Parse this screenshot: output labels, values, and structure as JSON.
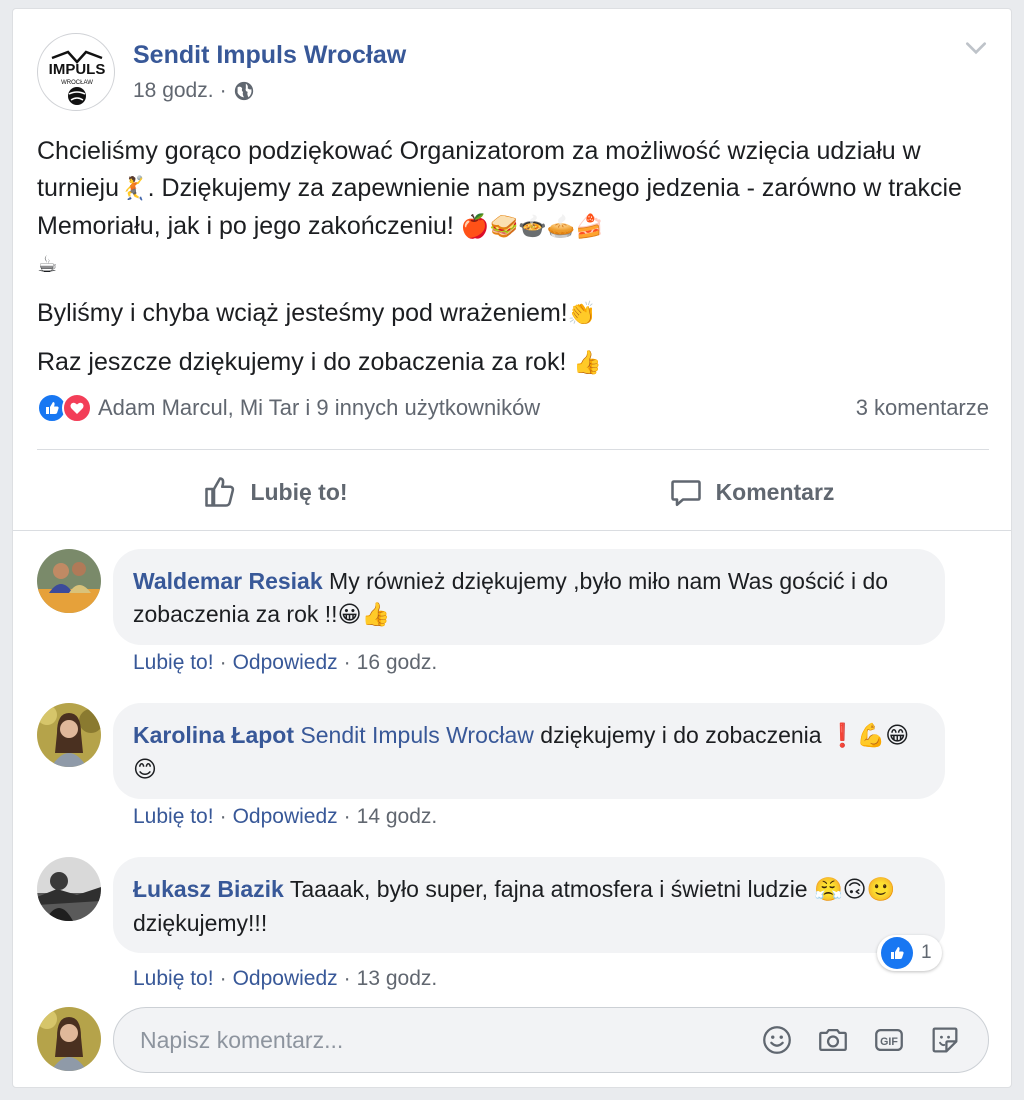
{
  "post": {
    "page_name": "Sendit Impuls Wrocław",
    "logo_text": "IMPULS",
    "logo_subtext": "WROCŁAW",
    "time": "18 godz.",
    "meta_separator": "·",
    "text": {
      "line1": "Chcieliśmy gorąco podziękować Organizatorom za możliwość wzięcia udziału w turnieju",
      "emoji_handball": "🤾",
      "line1b": ". Dziękujemy za zapewnienie nam pysznego jedzenia - zarówno w trakcie Memoriału, jak i po jego zakończeniu! ",
      "emoji_food": "🍎🥪🍲🥧🍰",
      "emoji_coffee": "☕",
      "line2": "Byliśmy i chyba wciąż jesteśmy pod wrażeniem!",
      "emoji_clap": "👏",
      "line3": "Raz jeszcze dziękujemy i do zobaczenia za rok! ",
      "emoji_thumb": "👍"
    },
    "reactions_text": "Adam Marcul, Mi Tar i 9 innych użytkowników",
    "comments_count": "3 komentarze"
  },
  "actions": {
    "like_label": "Lubię to!",
    "comment_label": "Komentarz"
  },
  "comments": [
    {
      "author": "Waldemar Resiak",
      "text": " My również dziękujemy ,było miło nam Was gościć i do zobaczenia za rok !!",
      "emoji": "😀👍",
      "like": "Lubię to!",
      "reply": "Odpowiedz",
      "sep": "·",
      "time": "16 godz."
    },
    {
      "author": "Karolina Łapot",
      "mention": "Sendit Impuls Wrocław",
      "text": " dziękujemy i do zobaczenia ",
      "emoji": "❗💪😁😊",
      "like": "Lubię to!",
      "reply": "Odpowiedz",
      "sep": "·",
      "time": "14 godz."
    },
    {
      "author": "Łukasz Biazik",
      "text": " Taaaak, było super, fajna atmosfera i świetni ludzie ",
      "emoji": "😤🙃🙂",
      "text_end": " dziękujemy!!!",
      "like": "Lubię to!",
      "reply": "Odpowiedz",
      "sep": "·",
      "time": "13 godz.",
      "reaction_count": "1"
    }
  ],
  "composer": {
    "placeholder": "Napisz komentarz..."
  },
  "icons": {
    "like": "like-icon",
    "love": "love-icon",
    "globe": "globe-icon",
    "chevron": "chevron-down-icon",
    "emoji": "smiley-icon",
    "camera": "camera-icon",
    "gif": "gif-icon",
    "sticker": "sticker-icon"
  },
  "colors": {
    "link": "#385898",
    "like_blue": "#1877f2",
    "love_red": "#f33e58",
    "bubble": "#f2f3f5"
  }
}
